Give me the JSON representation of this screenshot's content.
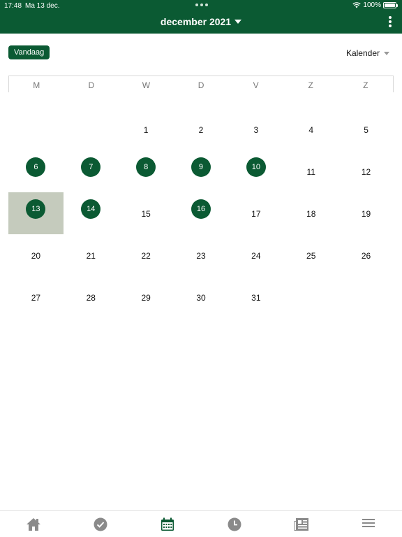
{
  "status": {
    "time": "17:48",
    "date": "Ma 13 dec.",
    "battery": "100%",
    "battery_level": 1.0
  },
  "header": {
    "title": "december 2021",
    "menu_icon": "more-vertical-icon"
  },
  "toolbar": {
    "today_label": "Vandaag",
    "view_label": "Kalender"
  },
  "weekdays": [
    "M",
    "D",
    "W",
    "D",
    "V",
    "Z",
    "Z"
  ],
  "calendar": {
    "weeks": [
      [
        {
          "d": ""
        },
        {
          "d": ""
        },
        {
          "d": "1"
        },
        {
          "d": "2"
        },
        {
          "d": "3"
        },
        {
          "d": "4"
        },
        {
          "d": "5"
        }
      ],
      [
        {
          "d": "6",
          "event": true
        },
        {
          "d": "7",
          "event": true
        },
        {
          "d": "8",
          "event": true
        },
        {
          "d": "9",
          "event": true
        },
        {
          "d": "10",
          "event": true
        },
        {
          "d": "11"
        },
        {
          "d": "12"
        }
      ],
      [
        {
          "d": "13",
          "event": true,
          "today": true
        },
        {
          "d": "14",
          "event": true
        },
        {
          "d": "15"
        },
        {
          "d": "16",
          "event": true
        },
        {
          "d": "17"
        },
        {
          "d": "18"
        },
        {
          "d": "19"
        }
      ],
      [
        {
          "d": "20"
        },
        {
          "d": "21"
        },
        {
          "d": "22"
        },
        {
          "d": "23"
        },
        {
          "d": "24"
        },
        {
          "d": "25"
        },
        {
          "d": "26"
        }
      ],
      [
        {
          "d": "27"
        },
        {
          "d": "28"
        },
        {
          "d": "29"
        },
        {
          "d": "30"
        },
        {
          "d": "31"
        },
        {
          "d": ""
        },
        {
          "d": ""
        }
      ]
    ]
  },
  "bottom_nav": [
    {
      "icon": "home-icon",
      "active": false
    },
    {
      "icon": "check-circle-icon",
      "active": false
    },
    {
      "icon": "calendar-icon",
      "active": true
    },
    {
      "icon": "clock-icon",
      "active": false
    },
    {
      "icon": "newspaper-icon",
      "active": false
    },
    {
      "icon": "menu-icon",
      "active": false
    }
  ],
  "colors": {
    "brand": "#0b5a33",
    "today_highlight": "#c5cbbd",
    "nav_inactive": "#8a8a8a"
  }
}
